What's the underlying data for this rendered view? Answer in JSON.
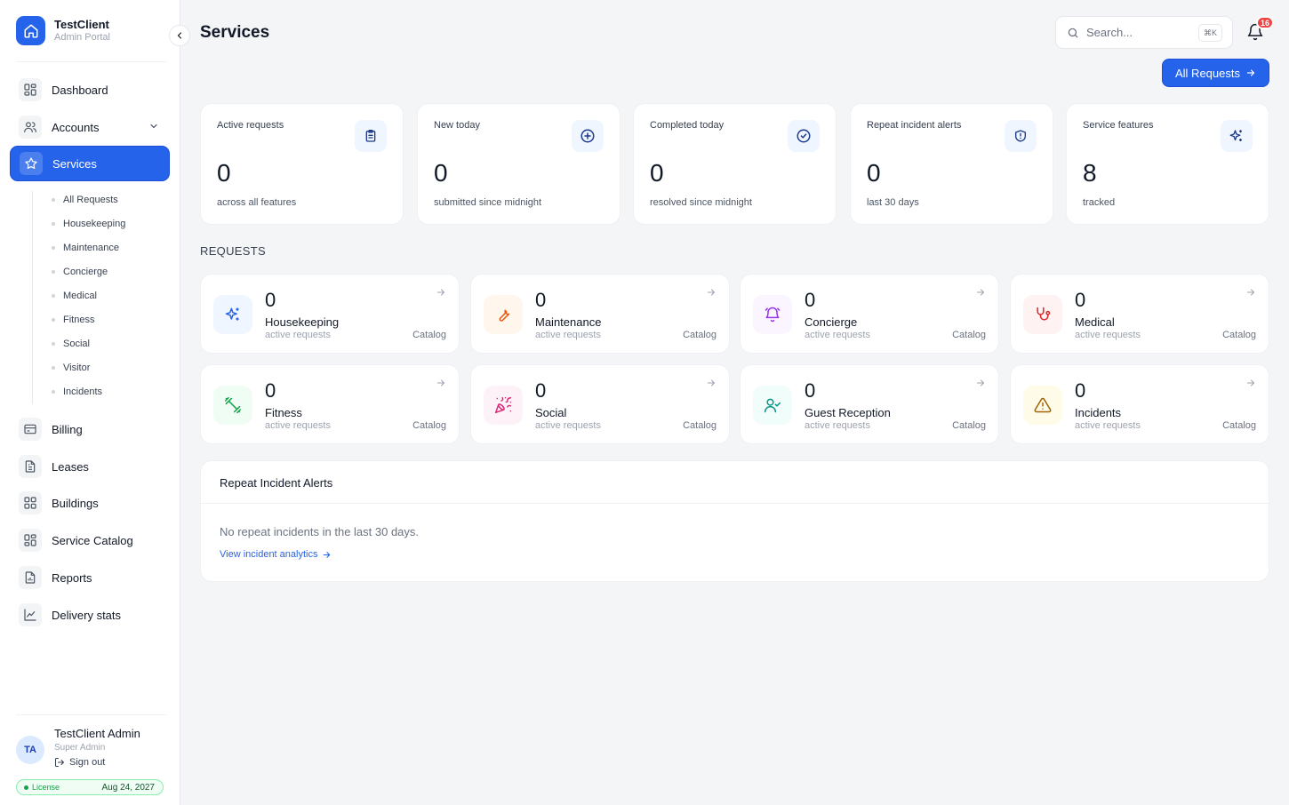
{
  "brand": {
    "name": "TestClient",
    "subtitle": "Admin Portal"
  },
  "sidebar": {
    "items": [
      {
        "label": "Dashboard"
      },
      {
        "label": "Accounts"
      },
      {
        "label": "Services"
      },
      {
        "label": "Billing"
      },
      {
        "label": "Leases"
      },
      {
        "label": "Buildings"
      },
      {
        "label": "Service Catalog"
      },
      {
        "label": "Reports"
      },
      {
        "label": "Delivery stats"
      }
    ],
    "services_sub": [
      "All Requests",
      "Housekeeping",
      "Maintenance",
      "Concierge",
      "Medical",
      "Fitness",
      "Social",
      "Visitor",
      "Incidents"
    ]
  },
  "user": {
    "initials": "TA",
    "name": "TestClient Admin",
    "role": "Super Admin",
    "signout": "Sign out"
  },
  "license": {
    "label": "License",
    "date": "Aug 24, 2027"
  },
  "header": {
    "title": "Services",
    "search_placeholder": "Search...",
    "shortcut": "⌘K",
    "notifications": "16",
    "primary_button": "All Requests"
  },
  "stats": [
    {
      "label": "Active requests",
      "value": "0",
      "sub": "across all features",
      "icon": "clipboard-icon"
    },
    {
      "label": "New today",
      "value": "0",
      "sub": "submitted since midnight",
      "icon": "plus-circle-icon"
    },
    {
      "label": "Completed today",
      "value": "0",
      "sub": "resolved since midnight",
      "icon": "check-circle-icon"
    },
    {
      "label": "Repeat incident alerts",
      "value": "0",
      "sub": "last 30 days",
      "icon": "shield-alert-icon"
    },
    {
      "label": "Service features",
      "value": "8",
      "sub": "tracked",
      "icon": "sparkles-icon"
    }
  ],
  "requests_section": {
    "title": "REQUESTS"
  },
  "requests": [
    {
      "name": "Housekeeping",
      "count": "0",
      "sub": "active requests",
      "link": "Catalog",
      "icon": "sparkles-icon",
      "color": "#2563eb",
      "bg": "#eff6ff"
    },
    {
      "name": "Maintenance",
      "count": "0",
      "sub": "active requests",
      "link": "Catalog",
      "icon": "wrench-icon",
      "color": "#ea580c",
      "bg": "#fff7ed"
    },
    {
      "name": "Concierge",
      "count": "0",
      "sub": "active requests",
      "link": "Catalog",
      "icon": "bell-concierge-icon",
      "color": "#9333ea",
      "bg": "#faf5ff"
    },
    {
      "name": "Medical",
      "count": "0",
      "sub": "active requests",
      "link": "Catalog",
      "icon": "stethoscope-icon",
      "color": "#dc2626",
      "bg": "#fef2f2"
    },
    {
      "name": "Fitness",
      "count": "0",
      "sub": "active requests",
      "link": "Catalog",
      "icon": "dumbbell-icon",
      "color": "#16a34a",
      "bg": "#f0fdf4"
    },
    {
      "name": "Social",
      "count": "0",
      "sub": "active requests",
      "link": "Catalog",
      "icon": "party-popper-icon",
      "color": "#db2777",
      "bg": "#fdf2f8"
    },
    {
      "name": "Guest Reception",
      "count": "0",
      "sub": "active requests",
      "link": "Catalog",
      "icon": "user-check-icon",
      "color": "#0d9488",
      "bg": "#f0fdfa"
    },
    {
      "name": "Incidents",
      "count": "0",
      "sub": "active requests",
      "link": "Catalog",
      "icon": "warning-icon",
      "color": "#a16207",
      "bg": "#fefce8"
    }
  ],
  "alerts": {
    "title": "Repeat Incident Alerts",
    "empty": "No repeat incidents in the last 30 days.",
    "link": "View incident analytics"
  },
  "colors": {
    "primary": "#2563eb",
    "background": "#f4f5f7",
    "badge": "#ef4444",
    "license": "#16a34a"
  }
}
